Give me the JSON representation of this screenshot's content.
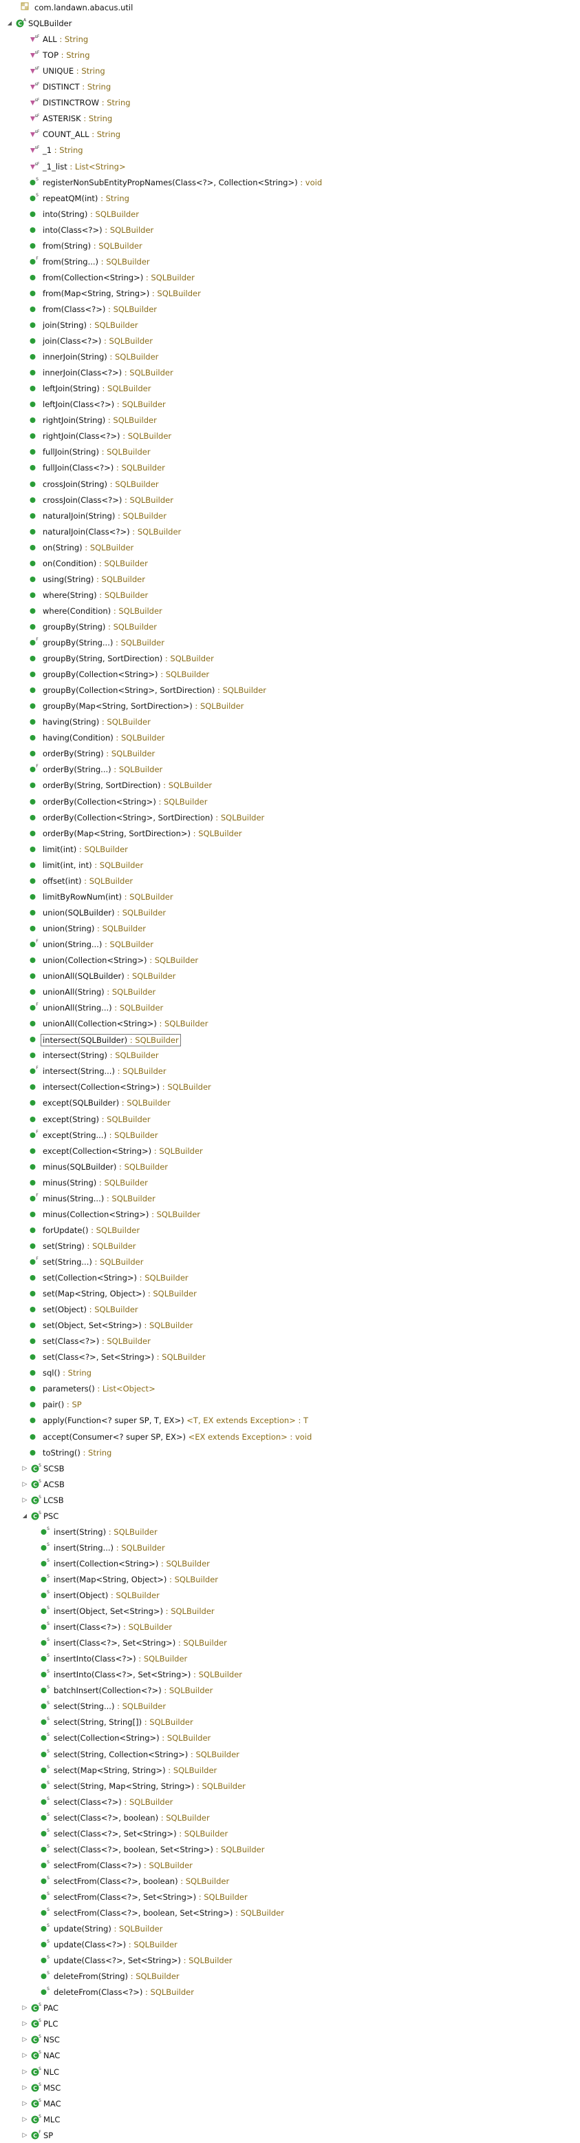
{
  "colors": {
    "accent": "#2a9d38",
    "field": "#b5478e",
    "return": "#8a6d1a",
    "package": "#b79d3e"
  },
  "rows": [
    {
      "level": 1,
      "kind": "package",
      "name": "com.landawn.abacus.util",
      "ret": ""
    },
    {
      "level": 0,
      "kind": "class",
      "expand": "open",
      "mod": "A",
      "name": "SQLBuilder",
      "ret": ""
    },
    {
      "level": 2,
      "kind": "field",
      "name": "ALL",
      "ret": "String"
    },
    {
      "level": 2,
      "kind": "field",
      "name": "TOP",
      "ret": "String"
    },
    {
      "level": 2,
      "kind": "field",
      "name": "UNIQUE",
      "ret": "String"
    },
    {
      "level": 2,
      "kind": "field",
      "name": "DISTINCT",
      "ret": "String"
    },
    {
      "level": 2,
      "kind": "field",
      "name": "DISTINCTROW",
      "ret": "String"
    },
    {
      "level": 2,
      "kind": "field",
      "name": "ASTERISK",
      "ret": "String"
    },
    {
      "level": 2,
      "kind": "field",
      "name": "COUNT_ALL",
      "ret": "String"
    },
    {
      "level": 2,
      "kind": "field",
      "name": "_1",
      "ret": "String"
    },
    {
      "level": 2,
      "kind": "field",
      "name": "_1_list",
      "ret": "List<String>"
    },
    {
      "level": 2,
      "kind": "method",
      "mod": "S",
      "name": "registerNonSubEntityPropNames(Class<?>, Collection<String>)",
      "ret": "void"
    },
    {
      "level": 2,
      "kind": "method",
      "mod": "S",
      "name": "repeatQM(int)",
      "ret": "String"
    },
    {
      "level": 2,
      "kind": "method",
      "name": "into(String)",
      "ret": "SQLBuilder"
    },
    {
      "level": 2,
      "kind": "method",
      "name": "into(Class<?>)",
      "ret": "SQLBuilder"
    },
    {
      "level": 2,
      "kind": "method",
      "name": "from(String)",
      "ret": "SQLBuilder"
    },
    {
      "level": 2,
      "kind": "method",
      "mod": "F",
      "name": "from(String...)",
      "ret": "SQLBuilder"
    },
    {
      "level": 2,
      "kind": "method",
      "name": "from(Collection<String>)",
      "ret": "SQLBuilder"
    },
    {
      "level": 2,
      "kind": "method",
      "name": "from(Map<String, String>)",
      "ret": "SQLBuilder"
    },
    {
      "level": 2,
      "kind": "method",
      "name": "from(Class<?>)",
      "ret": "SQLBuilder"
    },
    {
      "level": 2,
      "kind": "method",
      "name": "join(String)",
      "ret": "SQLBuilder"
    },
    {
      "level": 2,
      "kind": "method",
      "name": "join(Class<?>)",
      "ret": "SQLBuilder"
    },
    {
      "level": 2,
      "kind": "method",
      "name": "innerJoin(String)",
      "ret": "SQLBuilder"
    },
    {
      "level": 2,
      "kind": "method",
      "name": "innerJoin(Class<?>)",
      "ret": "SQLBuilder"
    },
    {
      "level": 2,
      "kind": "method",
      "name": "leftJoin(String)",
      "ret": "SQLBuilder"
    },
    {
      "level": 2,
      "kind": "method",
      "name": "leftJoin(Class<?>)",
      "ret": "SQLBuilder"
    },
    {
      "level": 2,
      "kind": "method",
      "name": "rightJoin(String)",
      "ret": "SQLBuilder"
    },
    {
      "level": 2,
      "kind": "method",
      "name": "rightJoin(Class<?>)",
      "ret": "SQLBuilder"
    },
    {
      "level": 2,
      "kind": "method",
      "name": "fullJoin(String)",
      "ret": "SQLBuilder"
    },
    {
      "level": 2,
      "kind": "method",
      "name": "fullJoin(Class<?>)",
      "ret": "SQLBuilder"
    },
    {
      "level": 2,
      "kind": "method",
      "name": "crossJoin(String)",
      "ret": "SQLBuilder"
    },
    {
      "level": 2,
      "kind": "method",
      "name": "crossJoin(Class<?>)",
      "ret": "SQLBuilder"
    },
    {
      "level": 2,
      "kind": "method",
      "name": "naturalJoin(String)",
      "ret": "SQLBuilder"
    },
    {
      "level": 2,
      "kind": "method",
      "name": "naturalJoin(Class<?>)",
      "ret": "SQLBuilder"
    },
    {
      "level": 2,
      "kind": "method",
      "name": "on(String)",
      "ret": "SQLBuilder"
    },
    {
      "level": 2,
      "kind": "method",
      "name": "on(Condition)",
      "ret": "SQLBuilder"
    },
    {
      "level": 2,
      "kind": "method",
      "name": "using(String)",
      "ret": "SQLBuilder"
    },
    {
      "level": 2,
      "kind": "method",
      "name": "where(String)",
      "ret": "SQLBuilder"
    },
    {
      "level": 2,
      "kind": "method",
      "name": "where(Condition)",
      "ret": "SQLBuilder"
    },
    {
      "level": 2,
      "kind": "method",
      "name": "groupBy(String)",
      "ret": "SQLBuilder"
    },
    {
      "level": 2,
      "kind": "method",
      "mod": "F",
      "name": "groupBy(String...)",
      "ret": "SQLBuilder"
    },
    {
      "level": 2,
      "kind": "method",
      "name": "groupBy(String, SortDirection)",
      "ret": "SQLBuilder"
    },
    {
      "level": 2,
      "kind": "method",
      "name": "groupBy(Collection<String>)",
      "ret": "SQLBuilder"
    },
    {
      "level": 2,
      "kind": "method",
      "name": "groupBy(Collection<String>, SortDirection)",
      "ret": "SQLBuilder"
    },
    {
      "level": 2,
      "kind": "method",
      "name": "groupBy(Map<String, SortDirection>)",
      "ret": "SQLBuilder"
    },
    {
      "level": 2,
      "kind": "method",
      "name": "having(String)",
      "ret": "SQLBuilder"
    },
    {
      "level": 2,
      "kind": "method",
      "name": "having(Condition)",
      "ret": "SQLBuilder"
    },
    {
      "level": 2,
      "kind": "method",
      "name": "orderBy(String)",
      "ret": "SQLBuilder"
    },
    {
      "level": 2,
      "kind": "method",
      "mod": "F",
      "name": "orderBy(String...)",
      "ret": "SQLBuilder"
    },
    {
      "level": 2,
      "kind": "method",
      "name": "orderBy(String, SortDirection)",
      "ret": "SQLBuilder"
    },
    {
      "level": 2,
      "kind": "method",
      "name": "orderBy(Collection<String>)",
      "ret": "SQLBuilder"
    },
    {
      "level": 2,
      "kind": "method",
      "name": "orderBy(Collection<String>, SortDirection)",
      "ret": "SQLBuilder"
    },
    {
      "level": 2,
      "kind": "method",
      "name": "orderBy(Map<String, SortDirection>)",
      "ret": "SQLBuilder"
    },
    {
      "level": 2,
      "kind": "method",
      "name": "limit(int)",
      "ret": "SQLBuilder"
    },
    {
      "level": 2,
      "kind": "method",
      "name": "limit(int, int)",
      "ret": "SQLBuilder"
    },
    {
      "level": 2,
      "kind": "method",
      "name": "offset(int)",
      "ret": "SQLBuilder"
    },
    {
      "level": 2,
      "kind": "method",
      "name": "limitByRowNum(int)",
      "ret": "SQLBuilder"
    },
    {
      "level": 2,
      "kind": "method",
      "name": "union(SQLBuilder)",
      "ret": "SQLBuilder"
    },
    {
      "level": 2,
      "kind": "method",
      "name": "union(String)",
      "ret": "SQLBuilder"
    },
    {
      "level": 2,
      "kind": "method",
      "mod": "F",
      "name": "union(String...)",
      "ret": "SQLBuilder"
    },
    {
      "level": 2,
      "kind": "method",
      "name": "union(Collection<String>)",
      "ret": "SQLBuilder"
    },
    {
      "level": 2,
      "kind": "method",
      "name": "unionAll(SQLBuilder)",
      "ret": "SQLBuilder"
    },
    {
      "level": 2,
      "kind": "method",
      "name": "unionAll(String)",
      "ret": "SQLBuilder"
    },
    {
      "level": 2,
      "kind": "method",
      "mod": "F",
      "name": "unionAll(String...)",
      "ret": "SQLBuilder"
    },
    {
      "level": 2,
      "kind": "method",
      "name": "unionAll(Collection<String>)",
      "ret": "SQLBuilder"
    },
    {
      "level": 2,
      "kind": "method",
      "name": "intersect(SQLBuilder)",
      "ret": "SQLBuilder",
      "selected": true
    },
    {
      "level": 2,
      "kind": "method",
      "name": "intersect(String)",
      "ret": "SQLBuilder"
    },
    {
      "level": 2,
      "kind": "method",
      "mod": "F",
      "name": "intersect(String...)",
      "ret": "SQLBuilder"
    },
    {
      "level": 2,
      "kind": "method",
      "name": "intersect(Collection<String>)",
      "ret": "SQLBuilder"
    },
    {
      "level": 2,
      "kind": "method",
      "name": "except(SQLBuilder)",
      "ret": "SQLBuilder"
    },
    {
      "level": 2,
      "kind": "method",
      "name": "except(String)",
      "ret": "SQLBuilder"
    },
    {
      "level": 2,
      "kind": "method",
      "mod": "F",
      "name": "except(String...)",
      "ret": "SQLBuilder"
    },
    {
      "level": 2,
      "kind": "method",
      "name": "except(Collection<String>)",
      "ret": "SQLBuilder"
    },
    {
      "level": 2,
      "kind": "method",
      "name": "minus(SQLBuilder)",
      "ret": "SQLBuilder"
    },
    {
      "level": 2,
      "kind": "method",
      "name": "minus(String)",
      "ret": "SQLBuilder"
    },
    {
      "level": 2,
      "kind": "method",
      "mod": "F",
      "name": "minus(String...)",
      "ret": "SQLBuilder"
    },
    {
      "level": 2,
      "kind": "method",
      "name": "minus(Collection<String>)",
      "ret": "SQLBuilder"
    },
    {
      "level": 2,
      "kind": "method",
      "name": "forUpdate()",
      "ret": "SQLBuilder"
    },
    {
      "level": 2,
      "kind": "method",
      "name": "set(String)",
      "ret": "SQLBuilder"
    },
    {
      "level": 2,
      "kind": "method",
      "mod": "F",
      "name": "set(String...)",
      "ret": "SQLBuilder"
    },
    {
      "level": 2,
      "kind": "method",
      "name": "set(Collection<String>)",
      "ret": "SQLBuilder"
    },
    {
      "level": 2,
      "kind": "method",
      "name": "set(Map<String, Object>)",
      "ret": "SQLBuilder"
    },
    {
      "level": 2,
      "kind": "method",
      "name": "set(Object)",
      "ret": "SQLBuilder"
    },
    {
      "level": 2,
      "kind": "method",
      "name": "set(Object, Set<String>)",
      "ret": "SQLBuilder"
    },
    {
      "level": 2,
      "kind": "method",
      "name": "set(Class<?>)",
      "ret": "SQLBuilder"
    },
    {
      "level": 2,
      "kind": "method",
      "name": "set(Class<?>, Set<String>)",
      "ret": "SQLBuilder"
    },
    {
      "level": 2,
      "kind": "method",
      "name": "sql()",
      "ret": "String"
    },
    {
      "level": 2,
      "kind": "method",
      "name": "parameters()",
      "ret": "List<Object>"
    },
    {
      "level": 2,
      "kind": "method",
      "name": "pair()",
      "ret": "SP"
    },
    {
      "level": 2,
      "kind": "method",
      "name": "apply(Function<? super SP, T, EX>)",
      "tp": "<T, EX extends Exception>",
      "ret": "T"
    },
    {
      "level": 2,
      "kind": "method",
      "name": "accept(Consumer<? super SP, EX>)",
      "tp": "<EX extends Exception>",
      "ret": "void"
    },
    {
      "level": 2,
      "kind": "method",
      "name": "toString()",
      "ret": "String"
    },
    {
      "level": 1,
      "kind": "class",
      "expand": "closed",
      "mod": "S",
      "name": "SCSB",
      "ret": ""
    },
    {
      "level": 1,
      "kind": "class",
      "expand": "closed",
      "mod": "S",
      "name": "ACSB",
      "ret": ""
    },
    {
      "level": 1,
      "kind": "class",
      "expand": "closed",
      "mod": "S",
      "name": "LCSB",
      "ret": ""
    },
    {
      "level": 1,
      "kind": "class",
      "expand": "open",
      "mod": "S",
      "name": "PSC",
      "ret": ""
    },
    {
      "level": 3,
      "kind": "method",
      "mod": "S",
      "name": "insert(String)",
      "ret": "SQLBuilder"
    },
    {
      "level": 3,
      "kind": "method",
      "mod": "S",
      "name": "insert(String...)",
      "ret": "SQLBuilder"
    },
    {
      "level": 3,
      "kind": "method",
      "mod": "S",
      "name": "insert(Collection<String>)",
      "ret": "SQLBuilder"
    },
    {
      "level": 3,
      "kind": "method",
      "mod": "S",
      "name": "insert(Map<String, Object>)",
      "ret": "SQLBuilder"
    },
    {
      "level": 3,
      "kind": "method",
      "mod": "S",
      "name": "insert(Object)",
      "ret": "SQLBuilder"
    },
    {
      "level": 3,
      "kind": "method",
      "mod": "S",
      "name": "insert(Object, Set<String>)",
      "ret": "SQLBuilder"
    },
    {
      "level": 3,
      "kind": "method",
      "mod": "S",
      "name": "insert(Class<?>)",
      "ret": "SQLBuilder"
    },
    {
      "level": 3,
      "kind": "method",
      "mod": "S",
      "name": "insert(Class<?>, Set<String>)",
      "ret": "SQLBuilder"
    },
    {
      "level": 3,
      "kind": "method",
      "mod": "S",
      "name": "insertInto(Class<?>)",
      "ret": "SQLBuilder"
    },
    {
      "level": 3,
      "kind": "method",
      "mod": "S",
      "name": "insertInto(Class<?>, Set<String>)",
      "ret": "SQLBuilder"
    },
    {
      "level": 3,
      "kind": "method",
      "mod": "S",
      "name": "batchInsert(Collection<?>)",
      "ret": "SQLBuilder"
    },
    {
      "level": 3,
      "kind": "method",
      "mod": "S",
      "name": "select(String...)",
      "ret": "SQLBuilder"
    },
    {
      "level": 3,
      "kind": "method",
      "mod": "S",
      "name": "select(String, String[])",
      "ret": "SQLBuilder"
    },
    {
      "level": 3,
      "kind": "method",
      "mod": "S",
      "name": "select(Collection<String>)",
      "ret": "SQLBuilder"
    },
    {
      "level": 3,
      "kind": "method",
      "mod": "S",
      "name": "select(String, Collection<String>)",
      "ret": "SQLBuilder"
    },
    {
      "level": 3,
      "kind": "method",
      "mod": "S",
      "name": "select(Map<String, String>)",
      "ret": "SQLBuilder"
    },
    {
      "level": 3,
      "kind": "method",
      "mod": "S",
      "name": "select(String, Map<String, String>)",
      "ret": "SQLBuilder"
    },
    {
      "level": 3,
      "kind": "method",
      "mod": "S",
      "name": "select(Class<?>)",
      "ret": "SQLBuilder"
    },
    {
      "level": 3,
      "kind": "method",
      "mod": "S",
      "name": "select(Class<?>, boolean)",
      "ret": "SQLBuilder"
    },
    {
      "level": 3,
      "kind": "method",
      "mod": "S",
      "name": "select(Class<?>, Set<String>)",
      "ret": "SQLBuilder"
    },
    {
      "level": 3,
      "kind": "method",
      "mod": "S",
      "name": "select(Class<?>, boolean, Set<String>)",
      "ret": "SQLBuilder"
    },
    {
      "level": 3,
      "kind": "method",
      "mod": "S",
      "name": "selectFrom(Class<?>)",
      "ret": "SQLBuilder"
    },
    {
      "level": 3,
      "kind": "method",
      "mod": "S",
      "name": "selectFrom(Class<?>, boolean)",
      "ret": "SQLBuilder"
    },
    {
      "level": 3,
      "kind": "method",
      "mod": "S",
      "name": "selectFrom(Class<?>, Set<String>)",
      "ret": "SQLBuilder"
    },
    {
      "level": 3,
      "kind": "method",
      "mod": "S",
      "name": "selectFrom(Class<?>, boolean, Set<String>)",
      "ret": "SQLBuilder"
    },
    {
      "level": 3,
      "kind": "method",
      "mod": "S",
      "name": "update(String)",
      "ret": "SQLBuilder"
    },
    {
      "level": 3,
      "kind": "method",
      "mod": "S",
      "name": "update(Class<?>)",
      "ret": "SQLBuilder"
    },
    {
      "level": 3,
      "kind": "method",
      "mod": "S",
      "name": "update(Class<?>, Set<String>)",
      "ret": "SQLBuilder"
    },
    {
      "level": 3,
      "kind": "method",
      "mod": "S",
      "name": "deleteFrom(String)",
      "ret": "SQLBuilder"
    },
    {
      "level": 3,
      "kind": "method",
      "mod": "S",
      "name": "deleteFrom(Class<?>)",
      "ret": "SQLBuilder"
    },
    {
      "level": 1,
      "kind": "class",
      "expand": "closed",
      "mod": "S",
      "name": "PAC",
      "ret": ""
    },
    {
      "level": 1,
      "kind": "class",
      "expand": "closed",
      "mod": "S",
      "name": "PLC",
      "ret": ""
    },
    {
      "level": 1,
      "kind": "class",
      "expand": "closed",
      "mod": "S",
      "name": "NSC",
      "ret": ""
    },
    {
      "level": 1,
      "kind": "class",
      "expand": "closed",
      "mod": "S",
      "name": "NAC",
      "ret": ""
    },
    {
      "level": 1,
      "kind": "class",
      "expand": "closed",
      "mod": "S",
      "name": "NLC",
      "ret": ""
    },
    {
      "level": 1,
      "kind": "class",
      "expand": "closed",
      "mod": "S",
      "name": "MSC",
      "ret": ""
    },
    {
      "level": 1,
      "kind": "class",
      "expand": "closed",
      "mod": "S",
      "name": "MAC",
      "ret": ""
    },
    {
      "level": 1,
      "kind": "class",
      "expand": "closed",
      "mod": "S",
      "name": "MLC",
      "ret": ""
    },
    {
      "level": 1,
      "kind": "class",
      "expand": "closed",
      "mod": "F",
      "name": "SP",
      "ret": ""
    }
  ]
}
